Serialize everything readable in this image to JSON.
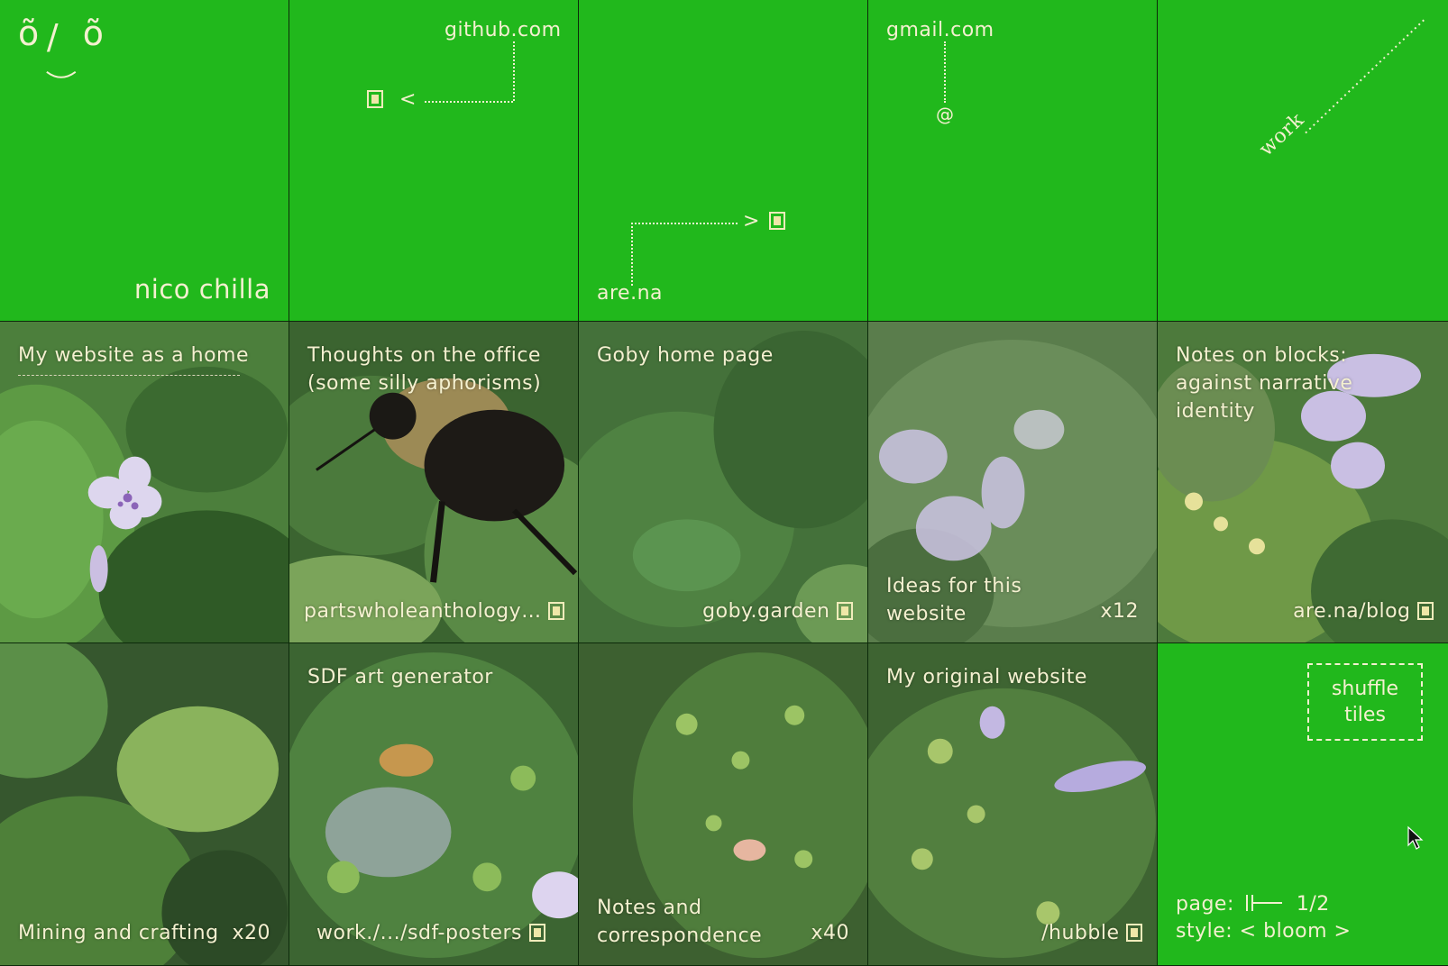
{
  "colors": {
    "green": "#21b81c",
    "text": "#f4f0d0",
    "divider": "#0c2a0a"
  },
  "row1": {
    "face": {
      "left_eye": "õ",
      "nose": "/",
      "right_eye": "õ",
      "name": "nico chilla"
    },
    "github": {
      "label": "github.com",
      "arrow": "<"
    },
    "arena": {
      "label": "are.na",
      "arrow": ">"
    },
    "gmail": {
      "label": "gmail.com",
      "at": "@"
    },
    "work": {
      "label": "work"
    }
  },
  "row2": [
    {
      "title": "My website as a home"
    },
    {
      "title": "Thoughts on the office (some silly aphorisms)",
      "link": "partswholeanthology…"
    },
    {
      "title": "Goby home page",
      "link": "goby.garden"
    },
    {
      "title": "Ideas for this website",
      "count": "x12"
    },
    {
      "title": "Notes on blocks: against narrative identity",
      "link": "are.na/blog"
    }
  ],
  "row3": [
    {
      "title": "Mining and crafting",
      "count": "x20"
    },
    {
      "title": "SDF art generator",
      "link": "work./.../sdf-posters"
    },
    {
      "title": "Notes and correspondence",
      "count": "x40"
    },
    {
      "title": "My original website",
      "link": "/hubble"
    }
  ],
  "controls": {
    "shuffle_label": "shuffle\ntiles",
    "page_label": "page:",
    "page_value": "1/2",
    "style_label": "style:",
    "style_prev": "<",
    "style_value": "bloom",
    "style_next": ">"
  }
}
